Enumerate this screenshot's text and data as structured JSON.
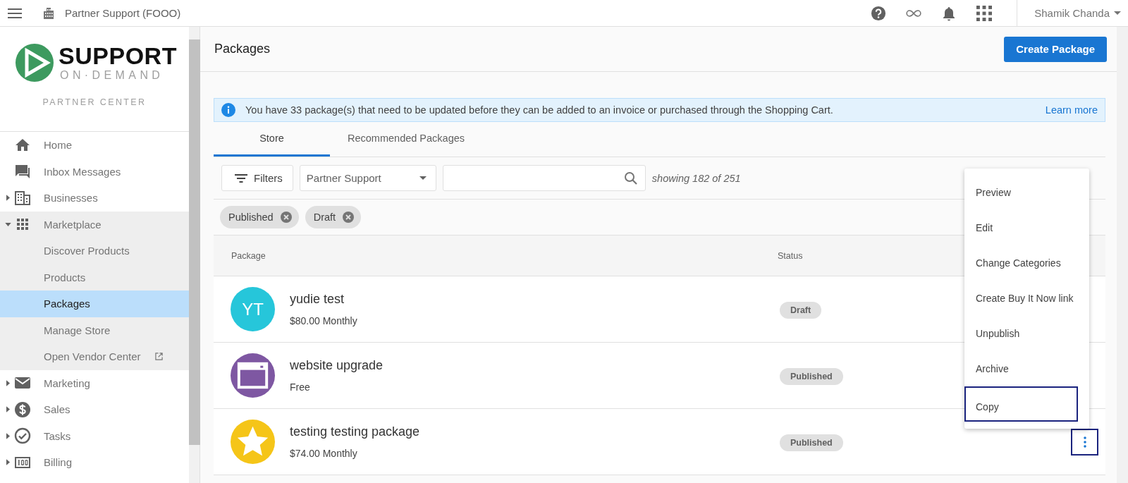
{
  "top_bar": {
    "account_name": "Partner Support (FOOO)",
    "user_name": "Shamik Chanda"
  },
  "sidebar": {
    "logo": {
      "line1": "SUPPORT",
      "line2": "ON·DEMAND"
    },
    "subtitle": "PARTNER CENTER",
    "items": [
      {
        "label": "Home",
        "kind": "link",
        "selected": false
      },
      {
        "label": "Inbox Messages",
        "kind": "link",
        "selected": false
      },
      {
        "label": "Businesses",
        "kind": "group",
        "expanded": false,
        "selected": false
      },
      {
        "label": "Marketplace",
        "kind": "group",
        "expanded": true,
        "selected": false,
        "children": [
          {
            "label": "Discover Products",
            "selected": false,
            "external": false
          },
          {
            "label": "Products",
            "selected": false,
            "external": false
          },
          {
            "label": "Packages",
            "selected": true,
            "external": false
          },
          {
            "label": "Manage Store",
            "selected": false,
            "external": false
          },
          {
            "label": "Open Vendor Center",
            "selected": false,
            "external": true
          }
        ]
      },
      {
        "label": "Marketing",
        "kind": "group",
        "expanded": false,
        "selected": false
      },
      {
        "label": "Sales",
        "kind": "group",
        "expanded": false,
        "selected": false
      },
      {
        "label": "Tasks",
        "kind": "group",
        "expanded": false,
        "selected": false
      },
      {
        "label": "Billing",
        "kind": "group",
        "expanded": false,
        "selected": false
      }
    ]
  },
  "page": {
    "title": "Packages",
    "create_button": "Create Package",
    "banner": {
      "text": "You have 33 package(s) that need to be updated before they can be added to an invoice or purchased through the Shopping Cart.",
      "link": "Learn more"
    },
    "tabs": [
      {
        "label": "Store",
        "selected": true
      },
      {
        "label": "Recommended Packages",
        "selected": false
      }
    ],
    "toolbar": {
      "filters_button": "Filters",
      "dropdown_value": "Partner Support",
      "count": "showing 182 of 251"
    },
    "chips": [
      {
        "label": "Published"
      },
      {
        "label": "Draft"
      }
    ],
    "table": {
      "columns": [
        "Package",
        "Status"
      ],
      "rows": [
        {
          "name": "yudie test",
          "price": "$80.00 Monthly",
          "status": "Draft",
          "avatar": {
            "kind": "initials",
            "text": "YT",
            "color": "#26c6da"
          },
          "menu_open": false
        },
        {
          "name": "website upgrade",
          "price": "Free",
          "status": "Published",
          "avatar": {
            "kind": "window",
            "color": "#7e57a2"
          },
          "menu_open": false
        },
        {
          "name": "testing testing package",
          "price": "$74.00 Monthly",
          "status": "Published",
          "avatar": {
            "kind": "star",
            "color": "#f5c518"
          },
          "menu_open": true
        }
      ]
    },
    "menu": {
      "items": [
        {
          "label": "Preview",
          "selected": false
        },
        {
          "label": "Edit",
          "selected": false
        },
        {
          "label": "Change Categories",
          "selected": false
        },
        {
          "label": "Create Buy It Now link",
          "selected": false
        },
        {
          "label": "Unpublish",
          "selected": false
        },
        {
          "label": "Archive",
          "selected": false
        },
        {
          "label": "Copy",
          "selected": true
        }
      ]
    }
  }
}
